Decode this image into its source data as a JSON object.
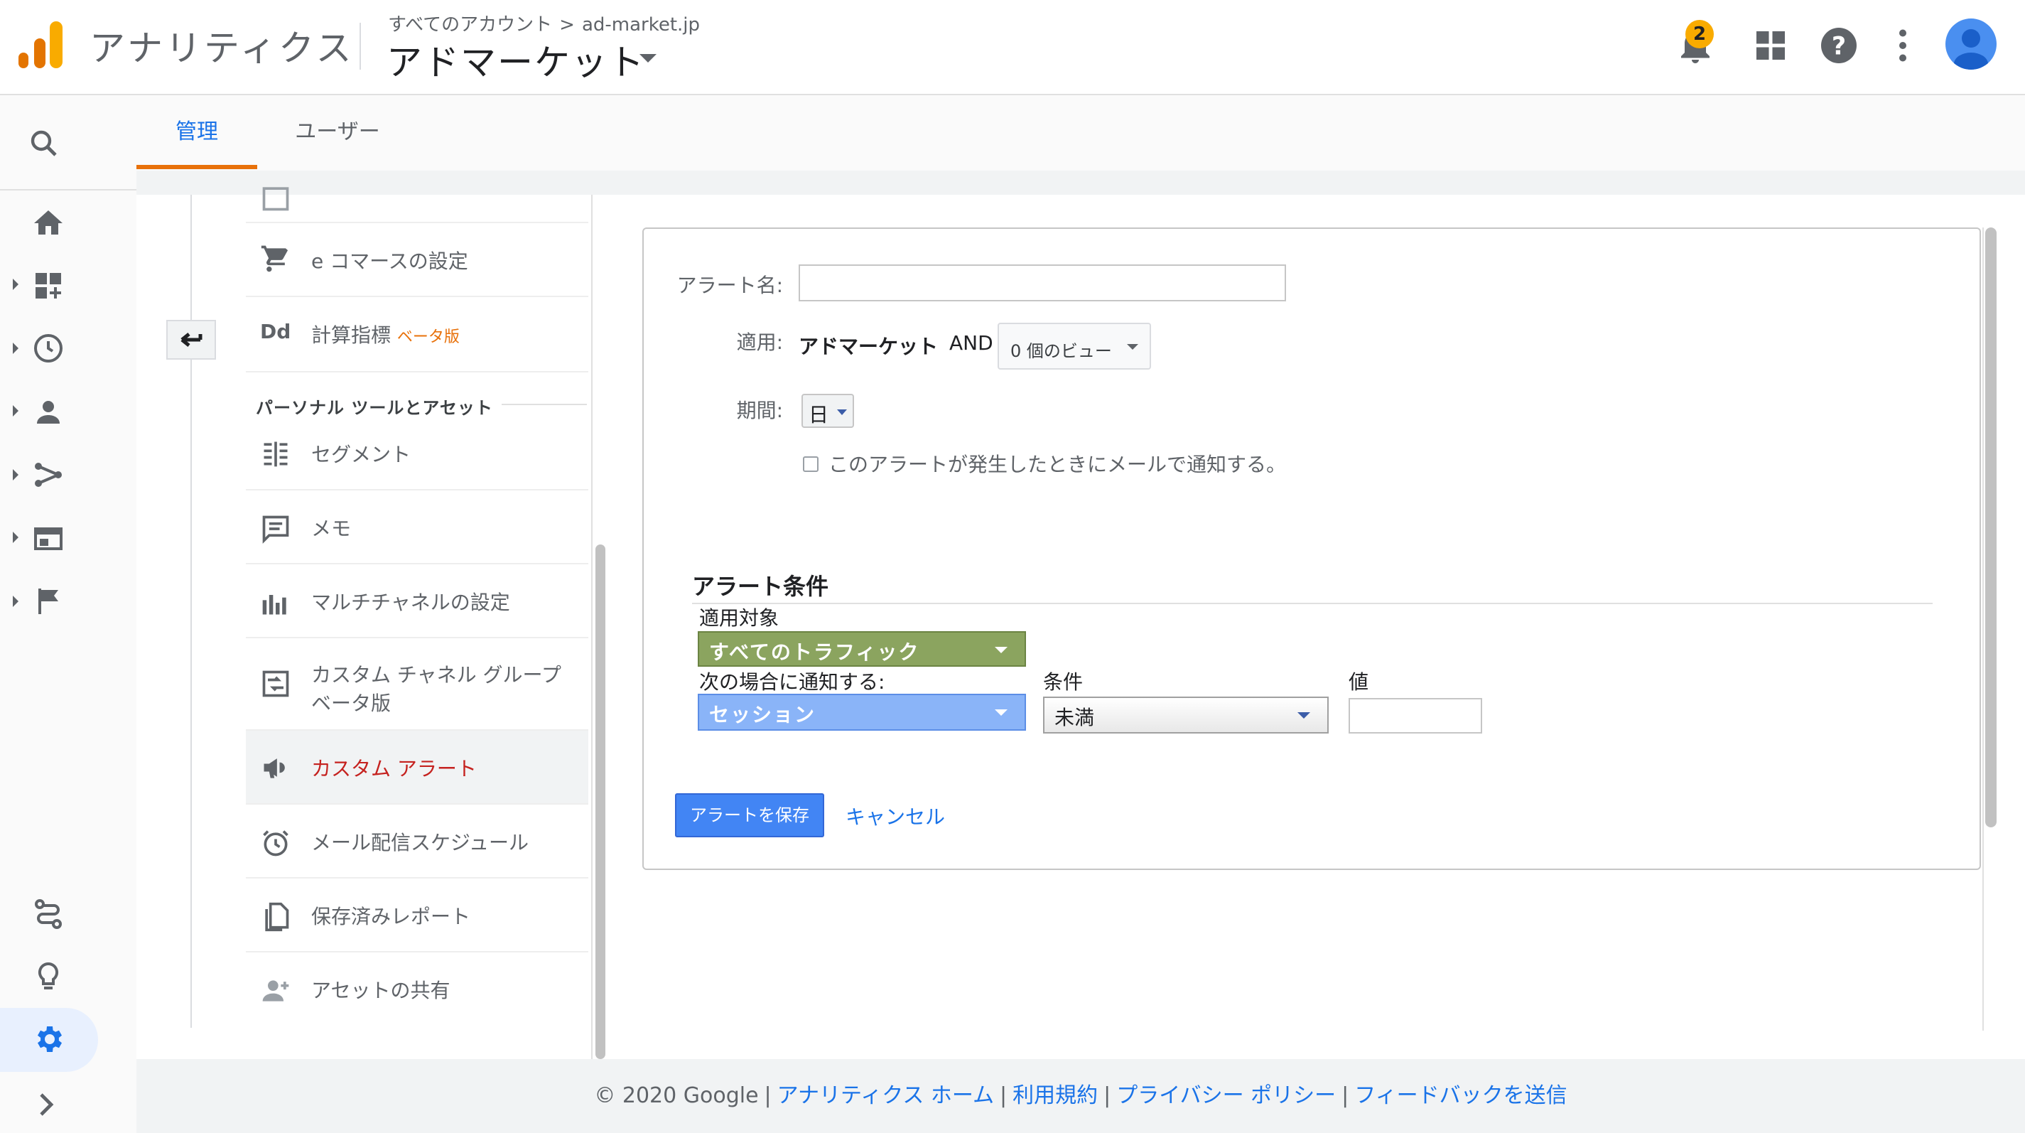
{
  "header": {
    "app_title": "アナリティクス",
    "breadcrumb_root": "すべてのアカウント",
    "breadcrumb_sep": ">",
    "breadcrumb_account": "ad-market.jp",
    "property_title": "アドマーケット",
    "notification_count": "2"
  },
  "tabs": [
    {
      "label": "管理",
      "active": true
    },
    {
      "label": "ユーザー",
      "active": false
    }
  ],
  "admin_nav": {
    "items_top": [
      {
        "label": "e コマースの設定",
        "icon": "cart-icon"
      },
      {
        "label": "計算指標",
        "badge": "ベータ版",
        "icon": "dd-icon"
      }
    ],
    "section_heading": "パーソナル ツールとアセット",
    "items": [
      {
        "label": "セグメント",
        "icon": "segment-icon"
      },
      {
        "label": "メモ",
        "icon": "annotation-icon"
      },
      {
        "label": "マルチチャネルの設定",
        "icon": "bar-chart-icon"
      },
      {
        "label": "カスタム チャネル グループ",
        "badge": "ベータ版",
        "icon": "channel-group-icon"
      },
      {
        "label": "カスタム アラート",
        "icon": "megaphone-icon",
        "active": true
      },
      {
        "label": "メール配信スケジュール",
        "icon": "alarm-clock-icon"
      },
      {
        "label": "保存済みレポート",
        "icon": "document-icon"
      },
      {
        "label": "アセットの共有",
        "icon": "add-person-icon"
      }
    ]
  },
  "alert_form": {
    "name_label": "アラート名:",
    "name_value": "",
    "apply_label": "適用:",
    "apply_property": "アドマーケット",
    "apply_and": "AND",
    "views_dropdown": "0 個のビュー",
    "period_label": "期間:",
    "period_value": "日",
    "email_checkbox_label": "このアラートが発生したときにメールで通知する。",
    "email_checked": false,
    "conditions_heading": "アラート条件",
    "applies_to_label": "適用対象",
    "applies_to_value": "すべてのトラフィック",
    "notify_when_label": "次の場合に通知する:",
    "metric_value": "セッション",
    "condition_label": "条件",
    "condition_value": "未満",
    "value_label": "値",
    "value_value": "",
    "save_label": "アラートを保存",
    "cancel_label": "キャンセル"
  },
  "footer": {
    "copyright": "© 2020 Google",
    "links": [
      "アナリティクス ホーム",
      "利用規約",
      "プライバシー ポリシー",
      "フィードバックを送信"
    ],
    "separator": "|"
  },
  "colors": {
    "accent_blue": "#1a73e8",
    "tab_underline": "#e8710a",
    "active_nav_text": "#c5221f",
    "traffic_select": "#8ba45f",
    "metric_select": "#8ab4f8",
    "save_button": "#4285f4",
    "logo_orange": "#f9ab00",
    "logo_dark_orange": "#e37400"
  }
}
